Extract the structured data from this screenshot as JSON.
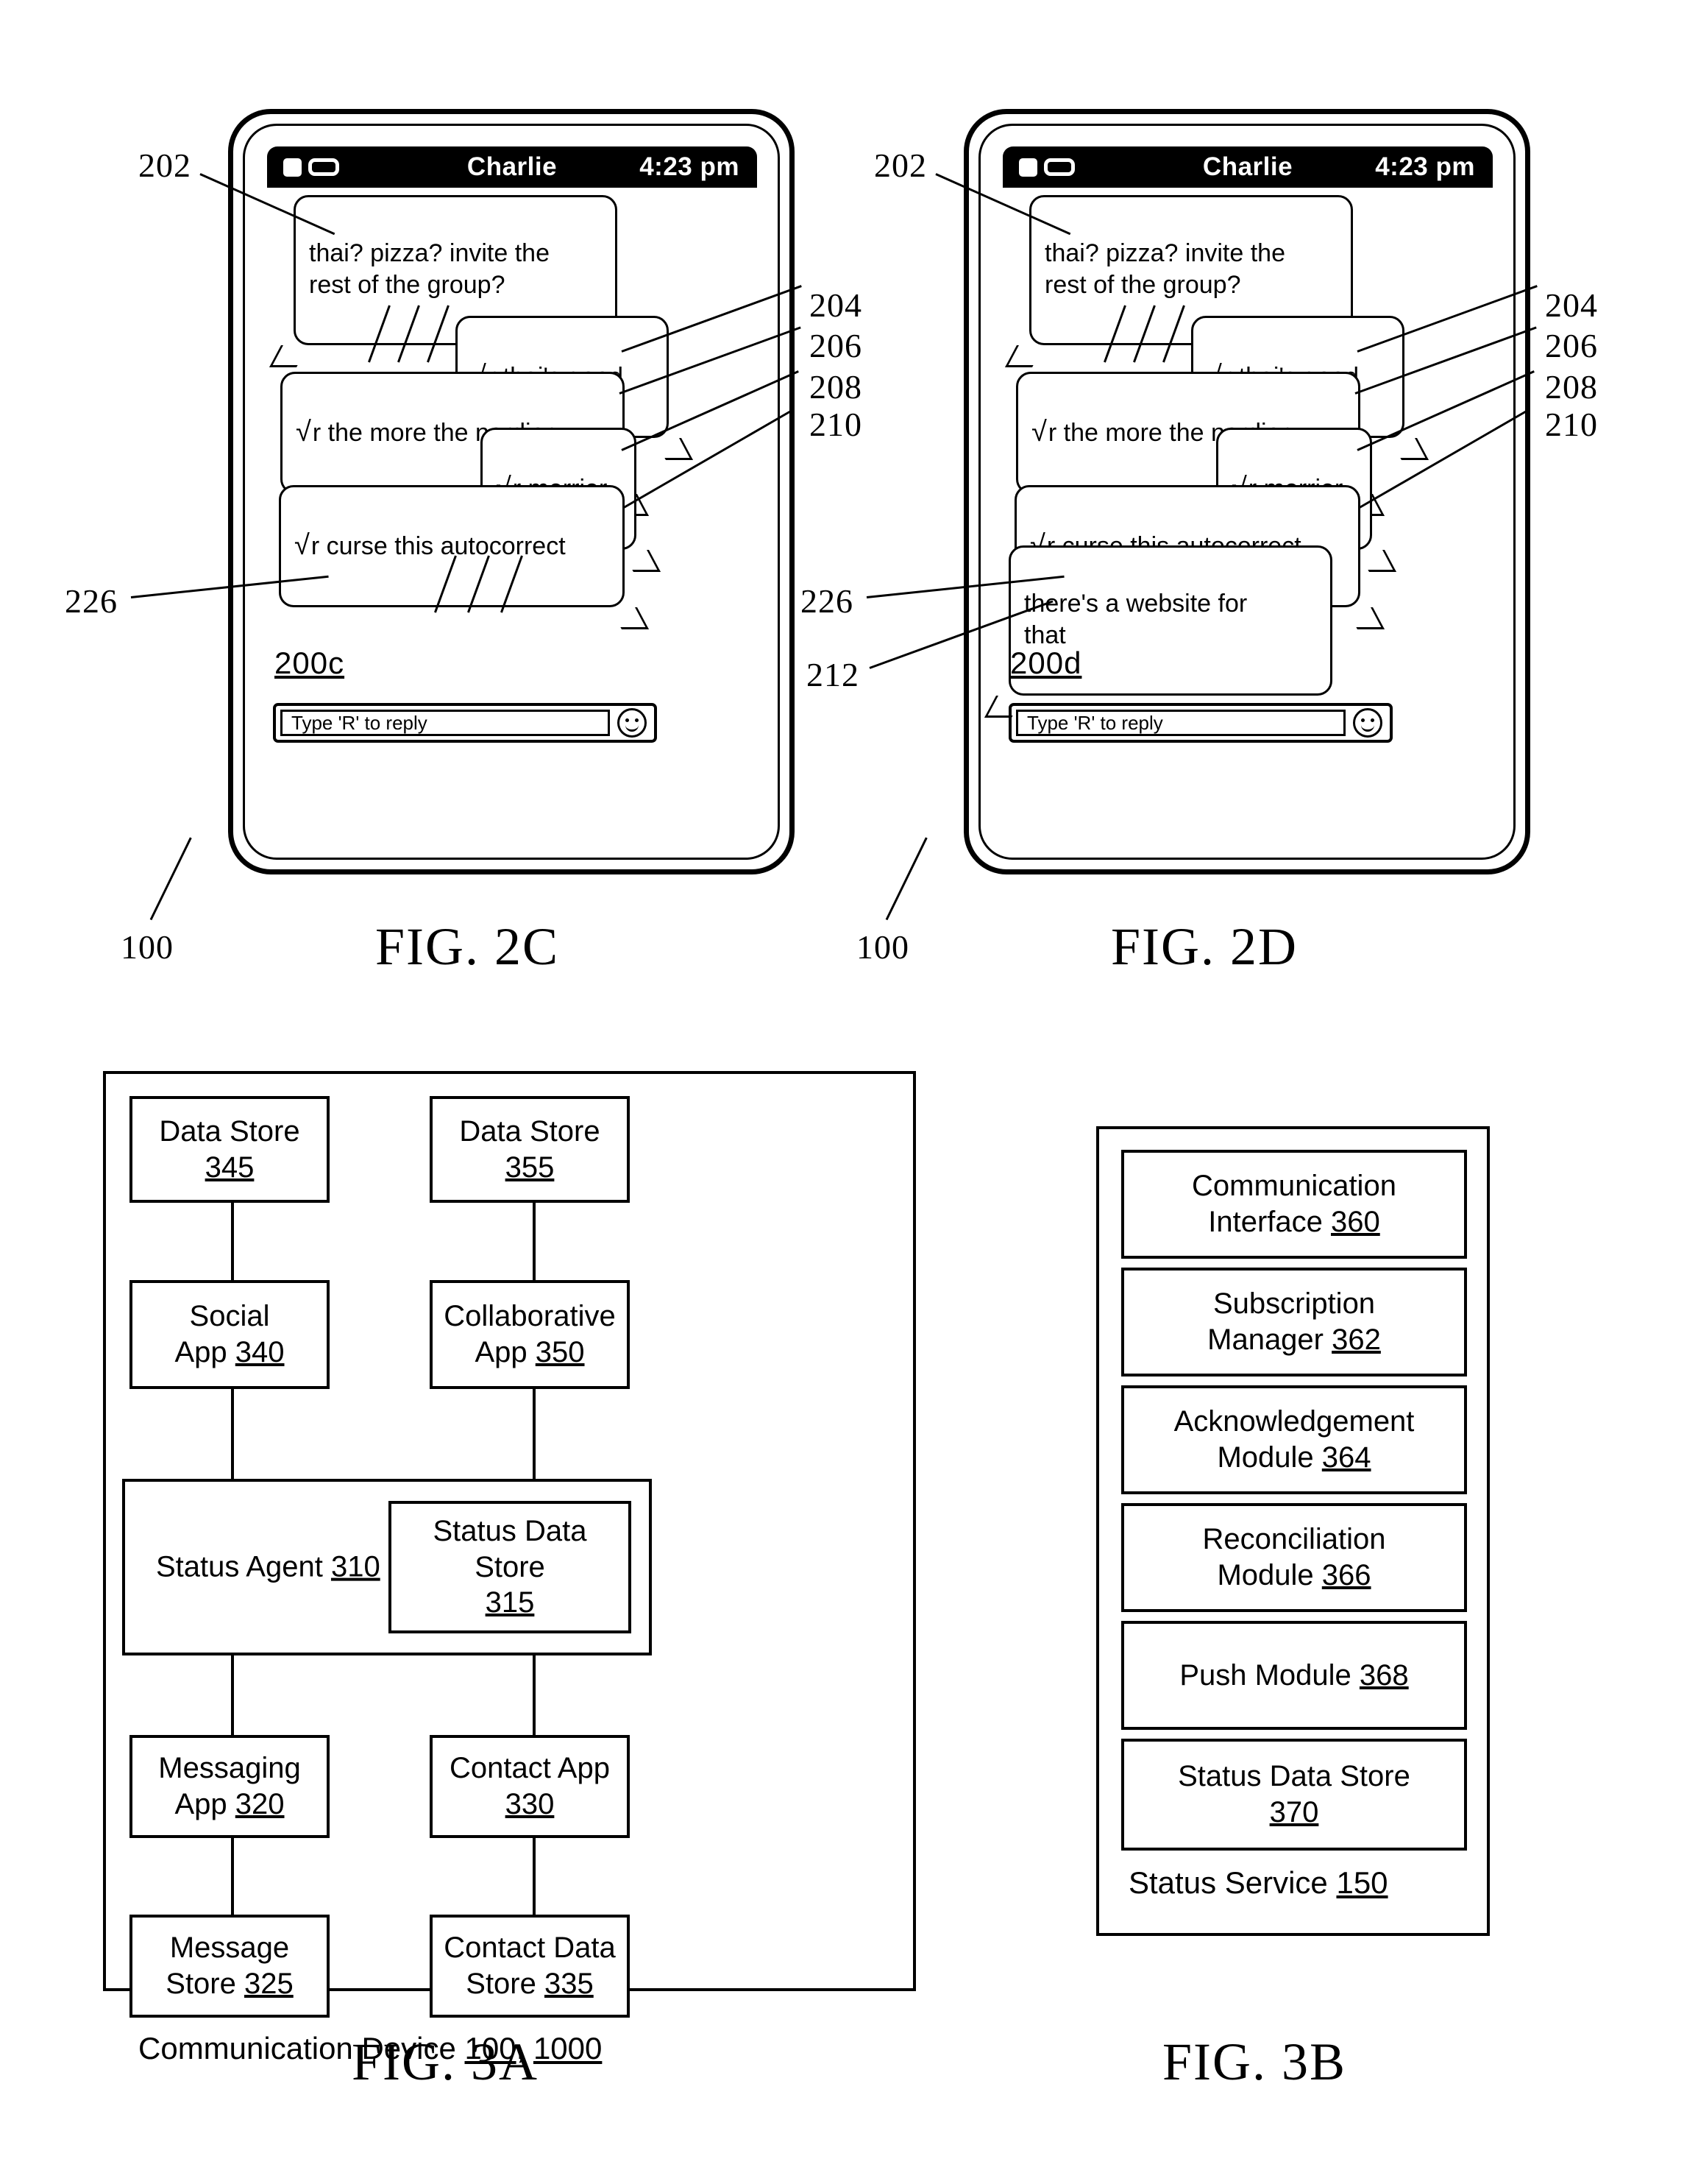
{
  "figures": {
    "fig2c": {
      "caption": "FIG. 2C",
      "screen_id": "200c",
      "device_ref": "100",
      "statusbar": {
        "title": "Charlie",
        "time": "4:23 pm",
        "signal_icon": "signal-icon",
        "battery_icon": "battery-icon"
      },
      "messages": [
        {
          "ref": "202",
          "text": "thai? pizza? invite the\nrest of the group?",
          "ack": "",
          "side": "left"
        },
        {
          "ref": "204",
          "text": "r thai's good",
          "ack": "√",
          "side": "right"
        },
        {
          "ref": "206",
          "text": "r the more the nerdier",
          "ack": "√",
          "side": "right"
        },
        {
          "ref": "208",
          "text": "r merrier",
          "ack": "√",
          "side": "right"
        },
        {
          "ref": "210",
          "text": "r curse this autocorrect",
          "ack": "√",
          "side": "right"
        }
      ],
      "ack_ref": "226",
      "input": {
        "placeholder": "Type 'R' to reply",
        "emoji_icon": "smiley-icon"
      }
    },
    "fig2d": {
      "caption": "FIG. 2D",
      "screen_id": "200d",
      "device_ref": "100",
      "statusbar": {
        "title": "Charlie",
        "time": "4:23 pm",
        "signal_icon": "signal-icon",
        "battery_icon": "battery-icon"
      },
      "messages": [
        {
          "ref": "202",
          "text": "thai? pizza? invite the\nrest of the group?",
          "ack": "",
          "side": "left"
        },
        {
          "ref": "204",
          "text": "r thai's good",
          "ack": "√",
          "side": "right"
        },
        {
          "ref": "206",
          "text": "r the more the nerdier",
          "ack": "√",
          "side": "right"
        },
        {
          "ref": "208",
          "text": "r merrier",
          "ack": "√",
          "side": "right"
        },
        {
          "ref": "210",
          "text": "r curse this autocorrect",
          "ack": "√",
          "side": "right"
        },
        {
          "ref": "212",
          "text": "there's a website for\nthat",
          "ack": "",
          "side": "left"
        }
      ],
      "ack_ref": "226",
      "input": {
        "placeholder": "Type 'R' to reply",
        "emoji_icon": "smiley-icon"
      }
    },
    "fig3a": {
      "caption": "FIG. 3A",
      "container_label_text": "Communication Device ",
      "container_label_ref1": "100",
      "container_label_sep": ", ",
      "container_label_ref2": "1000",
      "blocks": [
        {
          "id": "data-store-345",
          "line1": "Data Store",
          "line2": "345"
        },
        {
          "id": "data-store-355",
          "line1": "Data Store",
          "line2": "355"
        },
        {
          "id": "social-app-340",
          "line1": "Social",
          "line2": "App 340"
        },
        {
          "id": "collab-app-350",
          "line1": "Collaborative",
          "line2": "App 350"
        },
        {
          "id": "status-agent-310",
          "line1": "Status Agent 310",
          "line2": ""
        },
        {
          "id": "status-data-store-315",
          "line1": "Status Data Store",
          "line2": "315"
        },
        {
          "id": "messaging-app-320",
          "line1": "Messaging",
          "line2": "App 320"
        },
        {
          "id": "contact-app-330",
          "line1": "Contact App",
          "line2": "330"
        },
        {
          "id": "message-store-325",
          "line1": "Message",
          "line2": "Store 325"
        },
        {
          "id": "contact-data-store-335",
          "line1": "Contact Data",
          "line2": "Store 335"
        }
      ]
    },
    "fig3b": {
      "caption": "FIG. 3B",
      "container_label_text": "Status Service ",
      "container_label_ref": "150",
      "blocks": [
        {
          "id": "communication-interface-360",
          "line1": "Communication",
          "line2": "Interface 360"
        },
        {
          "id": "subscription-manager-362",
          "line1": "Subscription",
          "line2": "Manager 362"
        },
        {
          "id": "acknowledgement-module-364",
          "line1": "Acknowledgement",
          "line2": "Module 364"
        },
        {
          "id": "reconciliation-module-366",
          "line1": "Reconciliation",
          "line2": "Module 366"
        },
        {
          "id": "push-module-368",
          "line1": "Push Module 368",
          "line2": ""
        },
        {
          "id": "status-data-store-370",
          "line1": "Status Data Store",
          "line2": "370"
        }
      ]
    }
  }
}
